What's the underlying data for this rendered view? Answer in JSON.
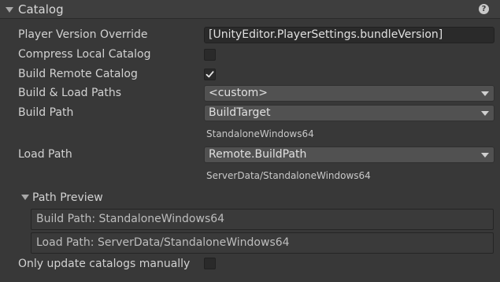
{
  "header": {
    "title": "Catalog",
    "help_glyph": "?"
  },
  "fields": {
    "player_version_override": {
      "label": "Player Version Override",
      "value": "[UnityEditor.PlayerSettings.bundleVersion]"
    },
    "compress_local_catalog": {
      "label": "Compress Local Catalog",
      "checked": false
    },
    "build_remote_catalog": {
      "label": "Build Remote Catalog",
      "checked": true
    },
    "build_load_paths": {
      "label": "Build & Load Paths",
      "selected": "<custom>"
    },
    "build_path": {
      "label": "Build Path",
      "selected": "BuildTarget",
      "resolved": "StandaloneWindows64"
    },
    "load_path": {
      "label": "Load Path",
      "selected": "Remote.BuildPath",
      "resolved": "ServerData/StandaloneWindows64"
    },
    "only_update_catalogs_manually": {
      "label": "Only update catalogs manually",
      "checked": false
    }
  },
  "path_preview": {
    "title": "Path Preview",
    "build_path": "Build Path: StandaloneWindows64",
    "load_path": "Load Path: ServerData/StandaloneWindows64"
  }
}
